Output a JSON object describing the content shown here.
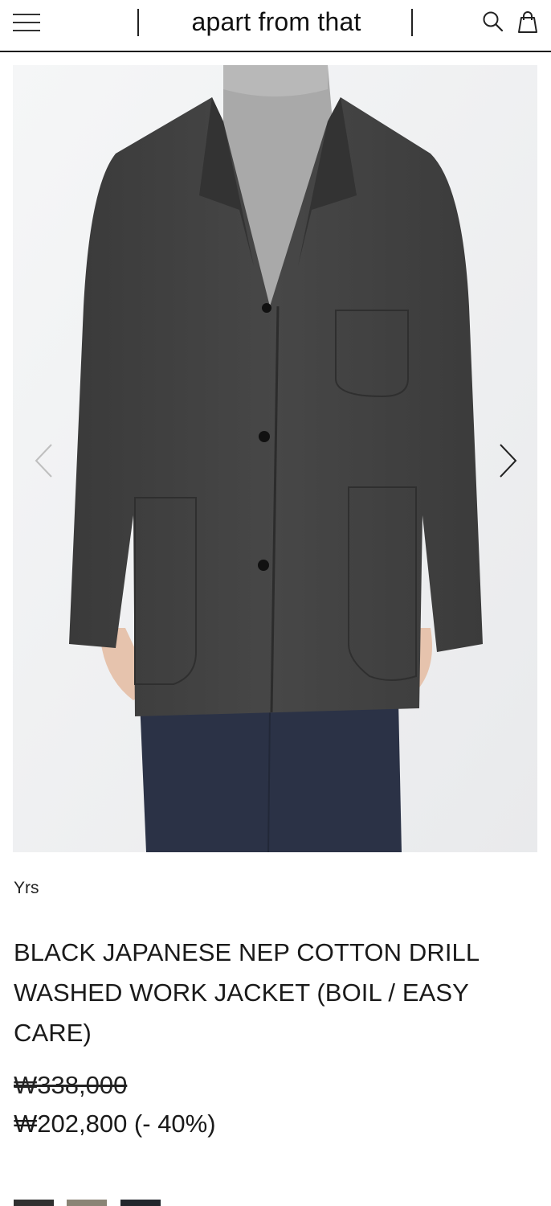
{
  "header": {
    "logo": "apart from that",
    "icons": {
      "menu": "hamburger-menu-icon",
      "search": "search-icon",
      "bag": "shopping-bag-icon"
    }
  },
  "gallery": {
    "image": "product-photo-jacket",
    "prev_icon": "chevron-left-icon",
    "next_icon": "chevron-right-icon"
  },
  "product": {
    "brand": "Yrs",
    "title": "BLACK JAPANESE NEP COTTON DRILL WASHED WORK JACKET (BOIL / EASY CARE)",
    "original_price": "₩338,000",
    "sale_price": "₩202,800 (- 40%)"
  },
  "colors": {
    "swatches": [
      "#303030",
      "#8a8475",
      "#22262c"
    ],
    "accent": "#1a1a1a"
  }
}
